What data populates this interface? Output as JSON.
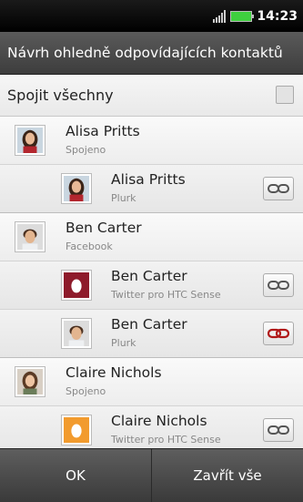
{
  "status": {
    "time": "14:23",
    "signal_icon": "signal-bars-icon",
    "battery_icon": "battery-icon"
  },
  "dialog": {
    "title": "Návrh ohledně odpovídajících kontaktů"
  },
  "join_all": {
    "label": "Spojit všechny",
    "checked": false
  },
  "groups": [
    {
      "parent": {
        "name": "Alisa Pritts",
        "source": "Spojeno"
      },
      "children": [
        {
          "name": "Alisa Pritts",
          "source": "Plurk",
          "linked": false
        }
      ]
    },
    {
      "parent": {
        "name": "Ben Carter",
        "source": "Facebook"
      },
      "children": [
        {
          "name": "Ben Carter",
          "source": "Twitter pro HTC Sense",
          "linked": false
        },
        {
          "name": "Ben Carter",
          "source": "Plurk",
          "linked": true
        }
      ]
    },
    {
      "parent": {
        "name": "Claire Nichols",
        "source": "Spojeno"
      },
      "children": [
        {
          "name": "Claire Nichols",
          "source": "Twitter pro HTC Sense",
          "linked": false
        }
      ]
    }
  ],
  "buttons": {
    "ok": "OK",
    "close_all": "Zavřít vše"
  }
}
